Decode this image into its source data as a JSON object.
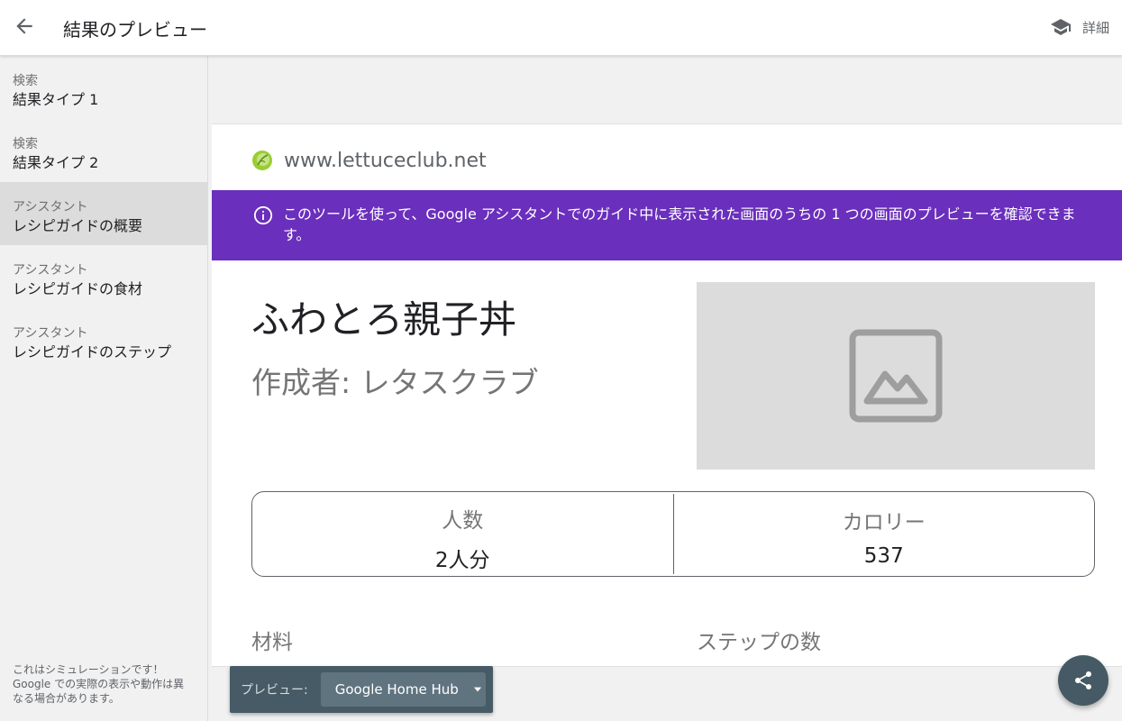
{
  "header": {
    "title": "結果のプレビュー",
    "details_label": "詳細"
  },
  "sidebar": {
    "items": [
      {
        "category": "検索",
        "label": "結果タイプ 1",
        "active": false
      },
      {
        "category": "検索",
        "label": "結果タイプ 2",
        "active": false
      },
      {
        "category": "アシスタント",
        "label": "レシピガイドの概要",
        "active": true
      },
      {
        "category": "アシスタント",
        "label": "レシピガイドの食材",
        "active": false
      },
      {
        "category": "アシスタント",
        "label": "レシピガイドのステップ",
        "active": false
      }
    ],
    "disclaimer": "これはシミュレーションです！ Google での実際の表示や動作は異なる場合があります。"
  },
  "preview": {
    "site_url": "www.lettuceclub.net",
    "info_banner": "このツールを使って、Google アシスタントでのガイド中に表示された画面のうちの 1 つの画面のプレビューを確認できます。",
    "recipe": {
      "title": "ふわとろ親子丼",
      "author": "作成者: レタスクラブ",
      "stats": [
        {
          "label": "人数",
          "value": "2人分"
        },
        {
          "label": "カロリー",
          "value": "537"
        }
      ],
      "ingredients_heading": "材料",
      "steps_heading": "ステップの数"
    }
  },
  "preview_bar": {
    "label": "プレビュー:",
    "device": "Google Home Hub"
  },
  "colors": {
    "banner": "#6a2fbc",
    "preview_bar": "#475b66",
    "fab": "#455a64",
    "sidebar_bg": "#f1f1f1",
    "active_item": "#dcdcdc"
  },
  "icons": {
    "back": "arrow-back-icon",
    "details": "school-icon",
    "site": "lettuce-favicon-icon",
    "info": "info-icon",
    "image": "image-placeholder-icon",
    "dropdown": "arrow-drop-down-icon",
    "share": "share-icon"
  }
}
